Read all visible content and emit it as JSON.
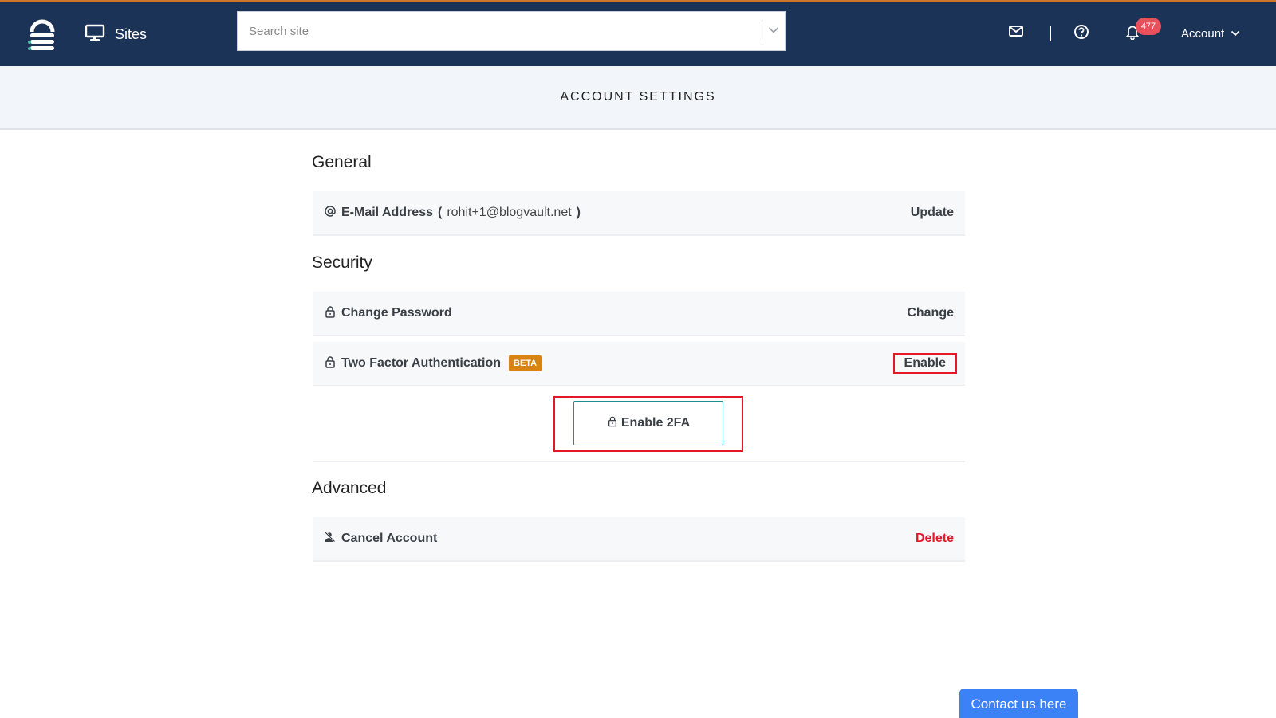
{
  "nav": {
    "sites_label": "Sites",
    "search_placeholder": "Search site",
    "notification_count": "477",
    "account_label": "Account"
  },
  "page": {
    "title": "ACCOUNT SETTINGS"
  },
  "general": {
    "heading": "General",
    "email_label": "E-Mail Address",
    "email_open": "(",
    "email_value": "rohit+1@blogvault.net",
    "email_close": ")",
    "email_action": "Update"
  },
  "security": {
    "heading": "Security",
    "password_label": "Change Password",
    "password_action": "Change",
    "twofa_label": "Two Factor Authentication",
    "twofa_badge": "BETA",
    "twofa_action": "Enable",
    "enable_2fa_button": "Enable 2FA"
  },
  "advanced": {
    "heading": "Advanced",
    "cancel_label": "Cancel Account",
    "cancel_action": "Delete"
  },
  "contact_button": "Contact us here",
  "colors": {
    "navbar": "#1c3358",
    "accent_top": "#d0762a",
    "danger": "#e4182a",
    "beta_badge": "#d98313",
    "badge": "#e8505b",
    "contact": "#3b82f6"
  },
  "icons": [
    "logo-icon",
    "monitor-icon",
    "chevron-down-icon",
    "mail-icon",
    "help-icon",
    "bell-icon",
    "at-icon",
    "lock-icon",
    "user-remove-icon"
  ]
}
